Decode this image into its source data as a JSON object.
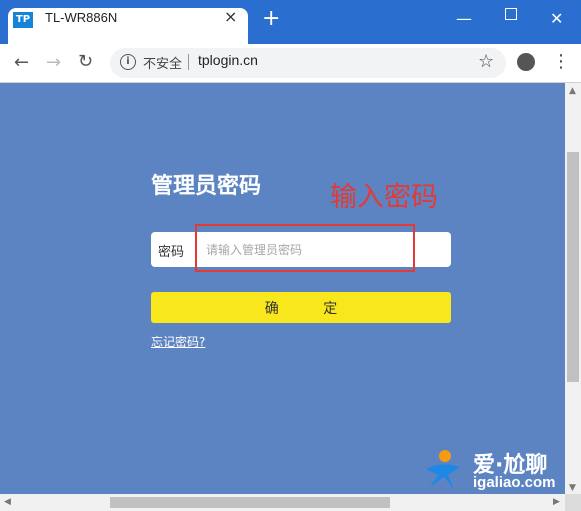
{
  "browser": {
    "tab_title": "TL-WR886N",
    "tab_logo": "TP",
    "close_glyph": "×",
    "new_tab_glyph": "+",
    "insecure_label": "不安全",
    "url": "tplogin.cn",
    "icons": [
      "back-icon",
      "forward-icon",
      "reload-icon",
      "info-icon",
      "star-icon",
      "account-icon",
      "menu-icon",
      "minimize-icon",
      "maximize-icon",
      "close-icon"
    ]
  },
  "login": {
    "title": "管理员密码",
    "field_label": "密码",
    "placeholder": "请输入管理员密码",
    "confirm_label": "确 定",
    "forgot_link": "忘记密码?"
  },
  "annotation": {
    "text": "输入密码",
    "color": "#e53935"
  },
  "watermark": {
    "name": "爱·尬聊",
    "url": "igaliao.com"
  },
  "colors": {
    "page_bg": "#5d84c2",
    "confirm_bg": "#f8e71c",
    "titlebar": "#2a6fcf"
  }
}
